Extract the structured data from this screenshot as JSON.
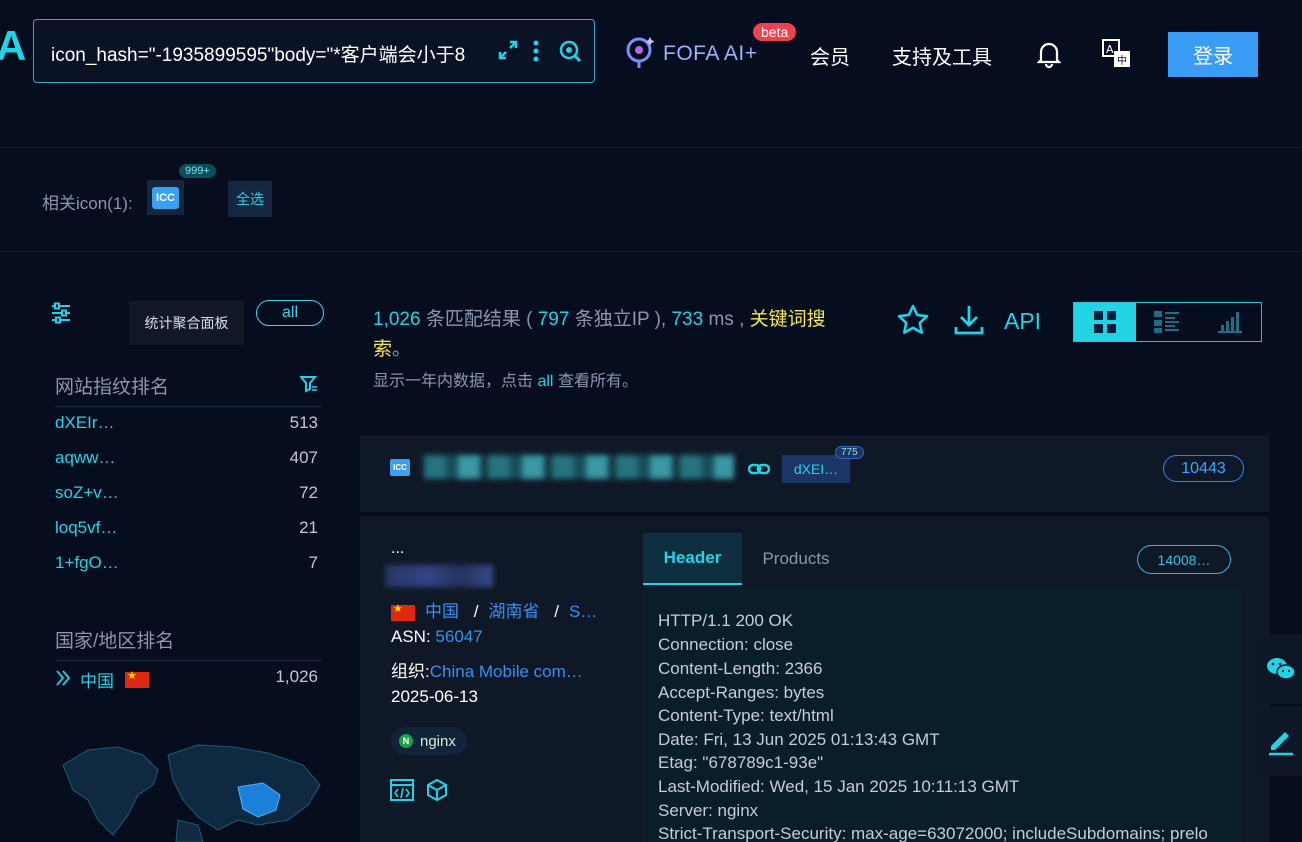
{
  "header": {
    "logo_fragment": "A",
    "search_query": "icon_hash=\"-1935899595\"body=\"*客户端会小于8",
    "ai_label": "FOFA AI+",
    "beta_badge": "beta",
    "nav_member": "会员",
    "nav_tools": "支持及工具",
    "login_label": "登录",
    "icons": [
      "expand-icon",
      "more-vertical-icon",
      "search-icon",
      "ai-icon",
      "bell-icon",
      "translate-icon"
    ]
  },
  "icon_row": {
    "label": "相关icon(1):",
    "icon_text": "ICC",
    "icon_badge": "999+",
    "select_all": "全选"
  },
  "sidebar": {
    "stat_panel_label": "统计聚合面板",
    "all_label": "all",
    "fingerprint_title": "网站指纹排名",
    "fingerprints": [
      {
        "name": "dXEIr…",
        "count": "513"
      },
      {
        "name": "aqww…",
        "count": "407"
      },
      {
        "name": "soZ+v…",
        "count": "72"
      },
      {
        "name": "loq5vf…",
        "count": "21"
      },
      {
        "name": "1+fgO…",
        "count": "7"
      }
    ],
    "country_title": "国家/地区排名",
    "countries": [
      {
        "name": "中国",
        "count": "1,026"
      }
    ]
  },
  "results": {
    "total": "1,026",
    "total_suffix": "条匹配结果 (",
    "unique_ip": "797",
    "unique_ip_suffix": "条独立IP ),",
    "time": "733",
    "time_unit": "ms ,",
    "keyword_search": "关键词搜",
    "keyword_search_2": "索",
    "period": "。",
    "notice_prefix": "显示一年内数据，点击",
    "notice_all": "all",
    "notice_suffix": "查看所有。",
    "api_label": "API"
  },
  "card": {
    "icon_text": "ICC",
    "fingerprint_tag": "dXEI…",
    "fingerprint_badge": "775",
    "port": "10443",
    "ellipsis": "...",
    "country": "中国",
    "province": "湖南省",
    "city": "S…",
    "sep": "/",
    "asn_label": "ASN:",
    "asn_value": "56047",
    "org_label": "组织:",
    "org_value": "China Mobile com…",
    "date": "2025-06-13",
    "tech": "nginx",
    "tab_header": "Header",
    "tab_products": "Products",
    "cert_badge": "14008…",
    "header_lines": [
      "HTTP/1.1 200 OK",
      "Connection: close",
      "Content-Length: 2366",
      "Accept-Ranges: bytes",
      "Content-Type: text/html",
      "Date: Fri, 13 Jun 2025 01:13:43 GMT",
      "Etag: \"678789c1-93e\"",
      "Last-Modified: Wed, 15 Jan 2025 10:11:13 GMT",
      "Server: nginx",
      "Strict-Transport-Security: max-age=63072000; includeSubdomains; prelo"
    ]
  },
  "colors": {
    "accent": "#22d3e6",
    "background": "#060d1e",
    "keyword": "#f3e84d",
    "login": "#3b9cf5",
    "beta": "#f0414f"
  }
}
